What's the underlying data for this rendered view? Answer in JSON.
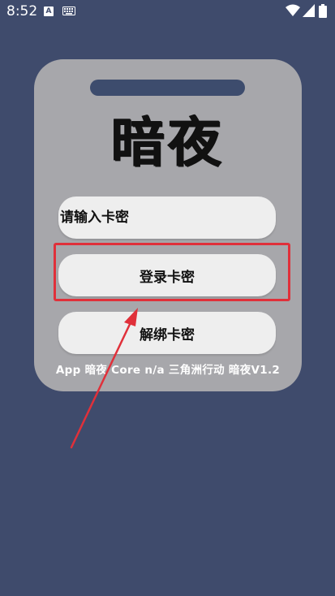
{
  "status_bar": {
    "time": "8:52",
    "notification_letter": "A"
  },
  "card": {
    "title": "暗夜",
    "card_input": {
      "placeholder": "请输入卡密",
      "value": ""
    },
    "login_button_label": "登录卡密",
    "unbind_button_label": "解绑卡密",
    "footer_text": "App 暗夜 Core n/a 三角洲行动 暗夜V1.2"
  },
  "colors": {
    "background": "#3f4b6c",
    "card": "#a7a7ab",
    "pill": "#eeeeee",
    "annotation": "#e0303a"
  }
}
